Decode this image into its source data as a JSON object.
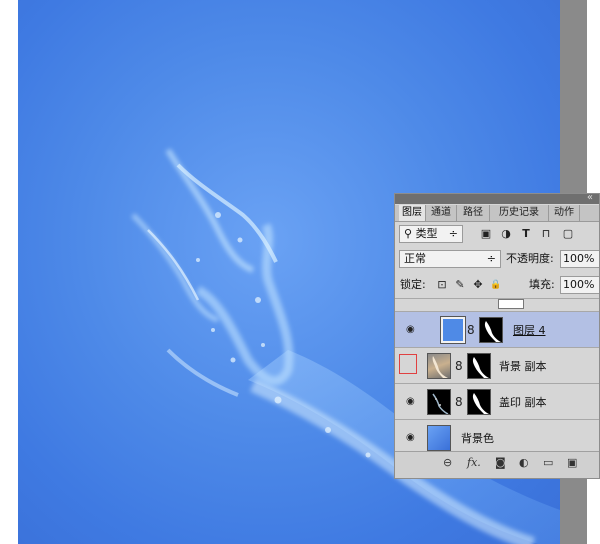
{
  "panel": {
    "tabs": [
      "图层",
      "通道",
      "路径",
      "历史记录",
      "动作"
    ],
    "filter": {
      "label": "类型",
      "arrow": "÷"
    },
    "blend_mode": {
      "value": "正常",
      "arrow": "÷"
    },
    "opacity": {
      "label": "不透明度:",
      "value": "100%"
    },
    "lock": {
      "label": "锁定:"
    },
    "fill": {
      "label": "填充:",
      "value": "100%"
    },
    "layers": [
      {
        "name": "图层 4",
        "visible": true,
        "selected": true
      },
      {
        "name": "背景 副本",
        "visible": false,
        "selected": false
      },
      {
        "name": "盖印 副本",
        "visible": true,
        "selected": false
      },
      {
        "name": "背景色",
        "visible": true,
        "selected": false
      }
    ],
    "collapse_glyph": "«",
    "bottom_icons": {
      "link": "⊖",
      "fx": "fx.",
      "mask": "◙",
      "adjust": "◐",
      "group": "▭",
      "new": "▣"
    }
  },
  "icons": {
    "eye": "◉",
    "link_chain": "8",
    "lock_pixels": "⊡",
    "lock_brush": "✎",
    "lock_move": "✥",
    "lock_all": "🔒",
    "filter_img": "▣",
    "filter_adj": "◑",
    "filter_text": "T",
    "filter_shape": "⊓",
    "filter_smart": "▢"
  },
  "colors": {
    "canvas_blue": "#4e8ae8",
    "selected_layer": "#b3c0e4"
  }
}
